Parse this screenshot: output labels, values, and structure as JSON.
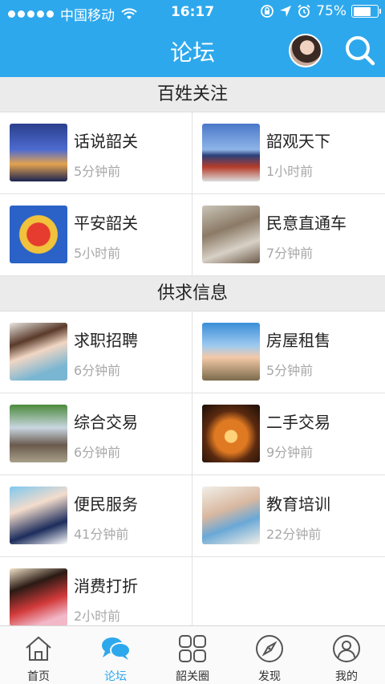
{
  "status_bar": {
    "carrier": "中国移动",
    "time": "16:17",
    "battery": "75%",
    "battery_level": 0.75
  },
  "nav": {
    "title": "论坛"
  },
  "sections": [
    {
      "title": "百姓关注",
      "items": [
        {
          "title": "话说韶关",
          "time": "5分钟前",
          "thumb": "city-night-photo"
        },
        {
          "title": "韶观天下",
          "time": "1小时前",
          "thumb": "temple-of-heaven-photo"
        },
        {
          "title": "平安韶关",
          "time": "5小时前",
          "thumb": "police-emblem"
        },
        {
          "title": "民意直通车",
          "time": "7分钟前",
          "thumb": "meeting-photo"
        }
      ]
    },
    {
      "title": "供求信息",
      "items": [
        {
          "title": "求职招聘",
          "time": "6分钟前",
          "thumb": "job-seeker-photo"
        },
        {
          "title": "房屋租售",
          "time": "5分钟前",
          "thumb": "house-key-photo"
        },
        {
          "title": "综合交易",
          "time": "6分钟前",
          "thumb": "market-photo"
        },
        {
          "title": "二手交易",
          "time": "9分钟前",
          "thumb": "lantern-photo"
        },
        {
          "title": "便民服务",
          "time": "41分钟前",
          "thumb": "service-agent-photo"
        },
        {
          "title": "教育培训",
          "time": "22分钟前",
          "thumb": "classroom-photo"
        },
        {
          "title": "消费打折",
          "time": "2小时前",
          "thumb": "shopping-photo"
        }
      ]
    }
  ],
  "tabbar": {
    "tabs": [
      {
        "label": "首页",
        "icon": "home-icon"
      },
      {
        "label": "论坛",
        "icon": "chat-bubbles-icon",
        "active": true
      },
      {
        "label": "韶关圈",
        "icon": "grid-icon"
      },
      {
        "label": "发现",
        "icon": "compass-icon"
      },
      {
        "label": "我的",
        "icon": "user-icon"
      }
    ]
  },
  "colors": {
    "brand": "#2ea8ec",
    "section_bg": "#ebebeb",
    "muted_text": "#a8a8a8"
  }
}
